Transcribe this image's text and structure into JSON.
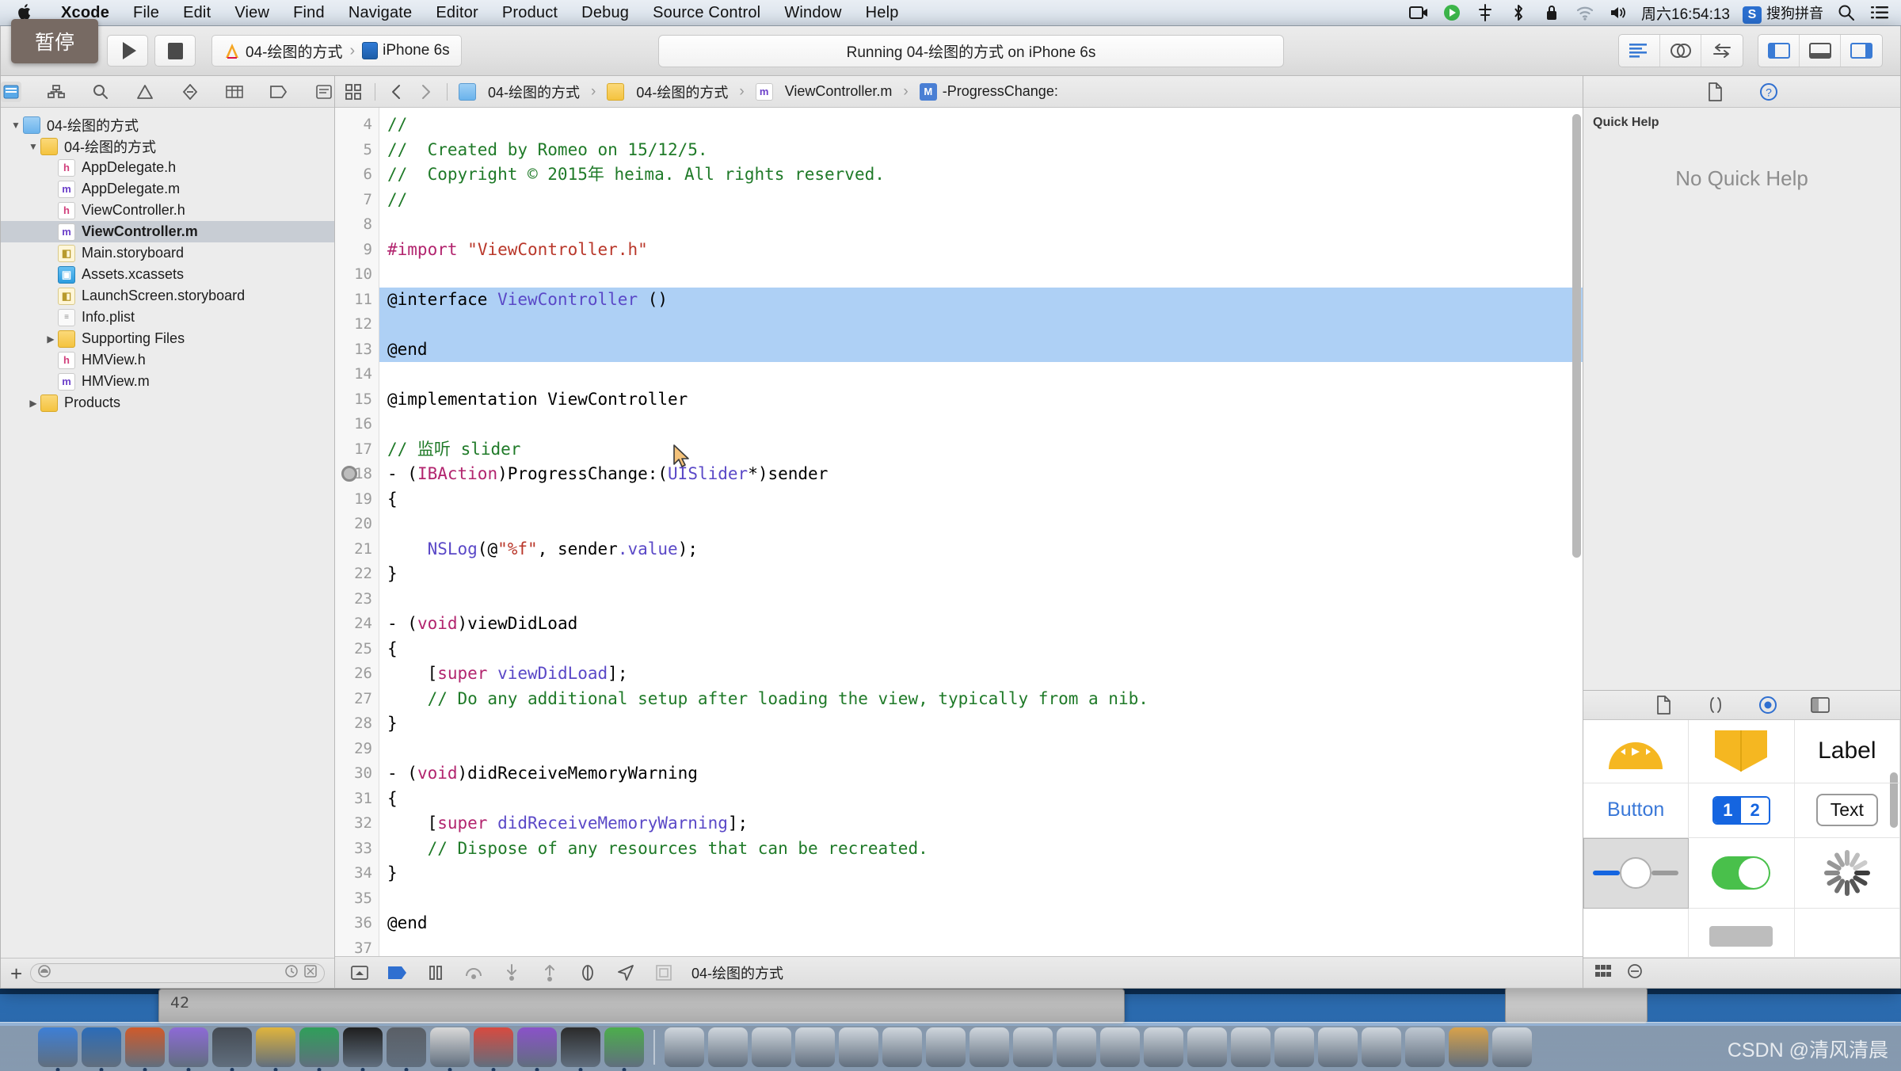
{
  "menubar": {
    "apple_icon": "apple-logo-icon",
    "items": [
      "Xcode",
      "File",
      "Edit",
      "View",
      "Find",
      "Navigate",
      "Editor",
      "Product",
      "Debug",
      "Source Control",
      "Window",
      "Help"
    ],
    "status_icons": [
      "screen-record-icon",
      "play-circle-icon",
      "airplay-icon",
      "bluetooth-icon",
      "lock-icon",
      "wifi-icon",
      "volume-icon"
    ],
    "clock": "周六16:54:13",
    "input_method": "搜狗拼音",
    "search_icon": "search-icon",
    "control-center_icon": "list-icon"
  },
  "tooltip": {
    "text": "暂停"
  },
  "toolbar": {
    "run_button": "run-play-button",
    "stop_button": "stop-button",
    "scheme_name": "04-绘图的方式",
    "scheme_separator": "›",
    "device_name": "iPhone 6s",
    "status_text": "Running 04-绘图的方式 on iPhone 6s",
    "editor_mode_icons": [
      "standard-editor-icon",
      "assistant-editor-icon",
      "version-editor-icon"
    ],
    "panel_toggle_icons": [
      "toggle-navigator-icon",
      "toggle-debug-area-icon",
      "toggle-utilities-icon"
    ]
  },
  "navigator": {
    "tabs": [
      "project-navigator-icon",
      "symbol-navigator-icon",
      "find-navigator-icon",
      "issue-navigator-icon",
      "test-navigator-icon",
      "debug-navigator-icon",
      "breakpoint-navigator-icon",
      "report-navigator-icon"
    ],
    "active_tab_index": 0,
    "tree": [
      {
        "label": "04-绘图的方式",
        "icon": "project-icon",
        "kind": "proj",
        "depth": 0,
        "disclosure": "open",
        "selected": false
      },
      {
        "label": "04-绘图的方式",
        "icon": "folder-icon",
        "kind": "folder",
        "depth": 1,
        "disclosure": "open",
        "selected": false
      },
      {
        "label": "AppDelegate.h",
        "icon": "header-file-icon",
        "kind": "h",
        "depth": 2,
        "disclosure": "none",
        "selected": false
      },
      {
        "label": "AppDelegate.m",
        "icon": "implementation-file-icon",
        "kind": "m",
        "depth": 2,
        "disclosure": "none",
        "selected": false
      },
      {
        "label": "ViewController.h",
        "icon": "header-file-icon",
        "kind": "h",
        "depth": 2,
        "disclosure": "none",
        "selected": false
      },
      {
        "label": "ViewController.m",
        "icon": "implementation-file-icon",
        "kind": "m",
        "depth": 2,
        "disclosure": "none",
        "selected": true
      },
      {
        "label": "Main.storyboard",
        "icon": "storyboard-file-icon",
        "kind": "sb",
        "depth": 2,
        "disclosure": "none",
        "selected": false
      },
      {
        "label": "Assets.xcassets",
        "icon": "assets-catalog-icon",
        "kind": "xc",
        "depth": 2,
        "disclosure": "none",
        "selected": false
      },
      {
        "label": "LaunchScreen.storyboard",
        "icon": "storyboard-file-icon",
        "kind": "sb",
        "depth": 2,
        "disclosure": "none",
        "selected": false
      },
      {
        "label": "Info.plist",
        "icon": "plist-file-icon",
        "kind": "plist",
        "depth": 2,
        "disclosure": "none",
        "selected": false
      },
      {
        "label": "Supporting Files",
        "icon": "folder-icon",
        "kind": "folder",
        "depth": 2,
        "disclosure": "closed",
        "selected": false
      },
      {
        "label": "HMView.h",
        "icon": "header-file-icon",
        "kind": "h",
        "depth": 2,
        "disclosure": "none",
        "selected": false
      },
      {
        "label": "HMView.m",
        "icon": "implementation-file-icon",
        "kind": "m",
        "depth": 2,
        "disclosure": "none",
        "selected": false
      },
      {
        "label": "Products",
        "icon": "folder-icon",
        "kind": "folder",
        "depth": 1,
        "disclosure": "closed",
        "selected": false
      }
    ],
    "filter": {
      "add_icon": "add-icon",
      "placeholder": "",
      "value": "",
      "recent_icon": "clock-icon",
      "scope_icon": "filter-scope-icon"
    }
  },
  "editor": {
    "jumpbar": {
      "related_items_icon": "related-items-icon",
      "back_icon": "back-chevron-icon",
      "forward_icon": "forward-chevron-icon",
      "crumbs": [
        {
          "label": "04-绘图的方式",
          "kind": "proj"
        },
        {
          "label": "04-绘图的方式",
          "kind": "folder"
        },
        {
          "label": "ViewController.m",
          "kind": "m"
        },
        {
          "label": "-ProgressChange:",
          "kind": "method"
        }
      ],
      "method_badge": "M",
      "separator": "›"
    },
    "first_line_number": 4,
    "selection_lines": [
      11,
      12,
      13
    ],
    "breakpoint_line": 18,
    "lines": [
      {
        "n": 4,
        "tokens": [
          [
            "//",
            "comment"
          ]
        ]
      },
      {
        "n": 5,
        "tokens": [
          [
            "//  Created by Romeo on 15/12/5.",
            "comment"
          ]
        ]
      },
      {
        "n": 6,
        "tokens": [
          [
            "//  Copyright © 2015年 heima. All rights reserved.",
            "comment"
          ]
        ]
      },
      {
        "n": 7,
        "tokens": [
          [
            "//",
            "comment"
          ]
        ]
      },
      {
        "n": 8,
        "tokens": []
      },
      {
        "n": 9,
        "tokens": [
          [
            "#import ",
            "pre"
          ],
          [
            "\"ViewController.h\"",
            "string"
          ]
        ]
      },
      {
        "n": 10,
        "tokens": []
      },
      {
        "n": 11,
        "tokens": [
          [
            "@interface",
            "keyword"
          ],
          [
            " ",
            "plain"
          ],
          [
            "ViewController",
            "type"
          ],
          [
            " ()",
            "plain"
          ]
        ]
      },
      {
        "n": 12,
        "tokens": []
      },
      {
        "n": 13,
        "tokens": [
          [
            "@end",
            "keyword"
          ]
        ]
      },
      {
        "n": 14,
        "tokens": []
      },
      {
        "n": 15,
        "tokens": [
          [
            "@implementation",
            "keyword"
          ],
          [
            " ",
            "plain"
          ],
          [
            "ViewController",
            "plain"
          ]
        ]
      },
      {
        "n": 16,
        "tokens": []
      },
      {
        "n": 17,
        "tokens": [
          [
            "// 监听 slider",
            "comment"
          ]
        ]
      },
      {
        "n": 18,
        "tokens": [
          [
            "- (",
            "plain"
          ],
          [
            "IBAction",
            "keyword"
          ],
          [
            ")ProgressChange:(",
            "plain"
          ],
          [
            "UISlider",
            "type"
          ],
          [
            "*)sender",
            "plain"
          ]
        ]
      },
      {
        "n": 19,
        "tokens": [
          [
            "{",
            "plain"
          ]
        ]
      },
      {
        "n": 20,
        "tokens": []
      },
      {
        "n": 21,
        "tokens": [
          "    ",
          "plain"
        ]
      },
      {
        "n": 22,
        "tokens": [
          [
            "}",
            "plain"
          ]
        ]
      },
      {
        "n": 23,
        "tokens": []
      },
      {
        "n": 24,
        "tokens": [
          [
            "- (",
            "plain"
          ],
          [
            "void",
            "keyword"
          ],
          [
            ")viewDidLoad",
            "plain"
          ]
        ]
      },
      {
        "n": 25,
        "tokens": [
          [
            "{",
            "plain"
          ]
        ]
      },
      {
        "n": 26,
        "tokens": []
      },
      {
        "n": 27,
        "tokens": []
      },
      {
        "n": 28,
        "tokens": [
          [
            "}",
            "plain"
          ]
        ]
      },
      {
        "n": 29,
        "tokens": []
      },
      {
        "n": 30,
        "tokens": [
          [
            "- (",
            "plain"
          ],
          [
            "void",
            "keyword"
          ],
          [
            ")didReceiveMemoryWarning",
            "plain"
          ]
        ]
      },
      {
        "n": 31,
        "tokens": [
          [
            "{",
            "plain"
          ]
        ]
      },
      {
        "n": 32,
        "tokens": []
      },
      {
        "n": 33,
        "tokens": []
      },
      {
        "n": 34,
        "tokens": [
          [
            "}",
            "plain"
          ]
        ]
      },
      {
        "n": 35,
        "tokens": []
      },
      {
        "n": 36,
        "tokens": [
          [
            "@end",
            "keyword"
          ]
        ]
      },
      {
        "n": 37,
        "tokens": []
      }
    ],
    "source_lines": [
      "//",
      "//  Created by Romeo on 15/12/5.",
      "//  Copyright © 2015年 heima. All rights reserved.",
      "//",
      "",
      "#import \"ViewController.h\"",
      "",
      "@interface ViewController ()",
      "",
      "@end",
      "",
      "@implementation ViewController",
      "",
      "// 监听 slider",
      "- (IBAction)ProgressChange:(UISlider*)sender",
      "{",
      "",
      "    NSLog(@\"%f\", sender.value);",
      "}",
      "",
      "- (void)viewDidLoad",
      "{",
      "    [super viewDidLoad];",
      "    // Do any additional setup after loading the view, typically from a nib.",
      "}",
      "",
      "- (void)didReceiveMemoryWarning",
      "{",
      "    [super didReceiveMemoryWarning];",
      "    // Dispose of any resources that can be recreated.",
      "}",
      "",
      "@end",
      ""
    ],
    "debug_bar": {
      "icons": [
        "hide-debug-area-icon",
        "breakpoints-toggle-icon",
        "pause-continue-icon",
        "step-over-icon",
        "step-into-icon",
        "step-out-icon",
        "debug-view-hierarchy-icon",
        "location-simulate-icon",
        "stack-frame-icon"
      ],
      "process_label": "04-绘图的方式"
    }
  },
  "inspector": {
    "tabs": [
      "file-inspector-icon",
      "quick-help-inspector-icon"
    ],
    "active_tab_index": 1,
    "quick_help_title": "Quick Help",
    "quick_help_body": "No Quick Help",
    "library_tabs": [
      "file-template-library-icon",
      "code-snippet-library-icon",
      "object-library-icon",
      "media-library-icon"
    ],
    "library_active_index": 2,
    "library_items": [
      {
        "name": "player-control-object",
        "label": "",
        "glyph": "pie"
      },
      {
        "name": "container-object",
        "label": "",
        "glyph": "book"
      },
      {
        "name": "label-object",
        "label": "Label",
        "glyph": "label"
      },
      {
        "name": "button-object",
        "label": "Button",
        "glyph": "button"
      },
      {
        "name": "segmented-control-object",
        "label": "1 2",
        "glyph": "segmented"
      },
      {
        "name": "text-field-object",
        "label": "Text",
        "glyph": "text"
      },
      {
        "name": "slider-object",
        "label": "",
        "glyph": "slider",
        "selected": true
      },
      {
        "name": "switch-object",
        "label": "",
        "glyph": "switch"
      },
      {
        "name": "activity-indicator-object",
        "label": "",
        "glyph": "spinner"
      }
    ],
    "library_footer_icons": [
      "grid-view-icon",
      "list-view-icon"
    ]
  },
  "background_window": {
    "number": "42"
  },
  "watermark": "CSDN @清风清晨"
}
